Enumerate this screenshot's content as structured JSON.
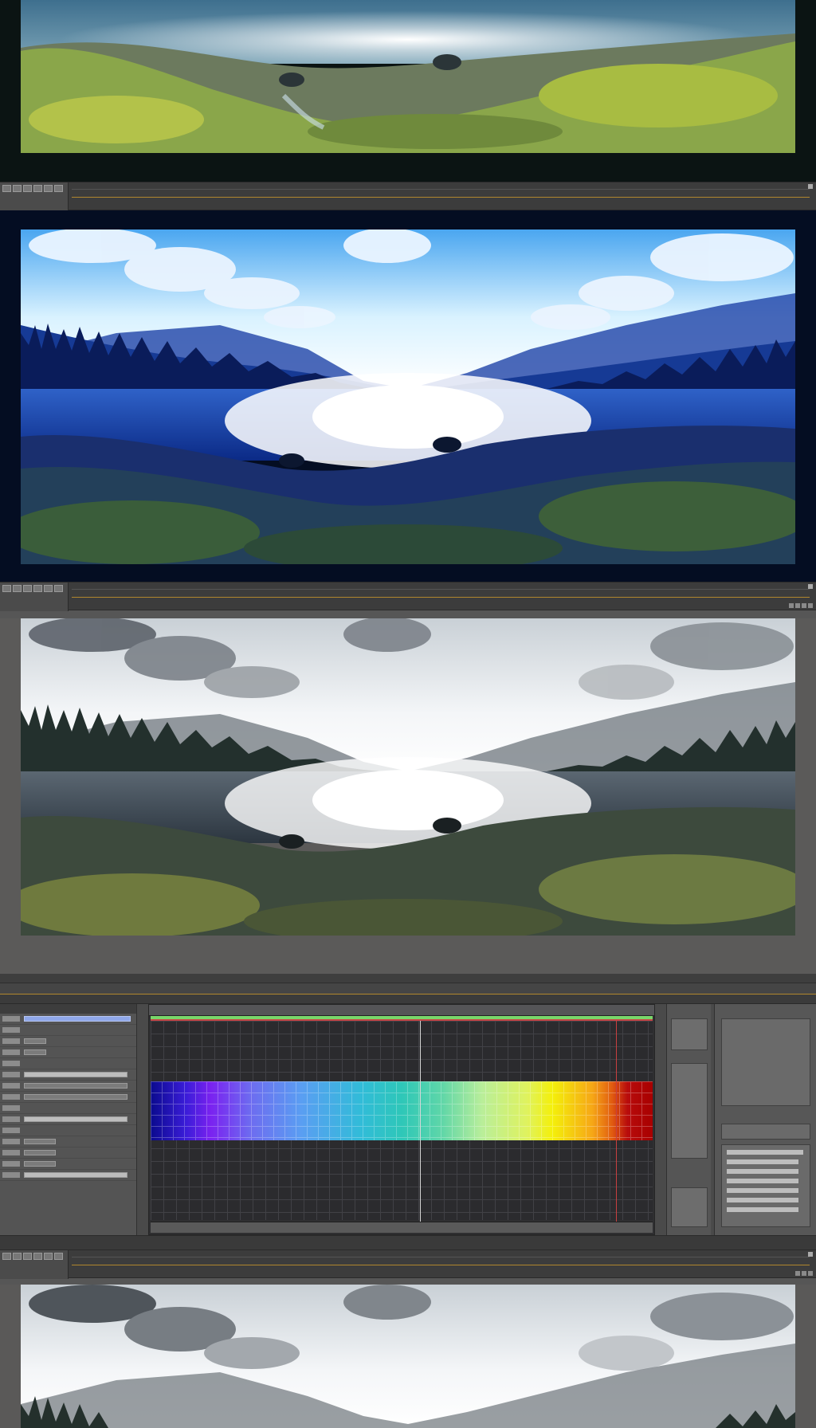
{
  "app": {
    "menu_text": "",
    "colors": {
      "accent_line": "#b0872e",
      "timeline_green": "#79d66a",
      "timeline_red": "#c84646",
      "panel_bg": "#545454"
    }
  },
  "frames": [
    {
      "name": "lake-landscape-natural"
    },
    {
      "name": "lake-landscape-blue-tint"
    },
    {
      "name": "lake-landscape-desaturated"
    },
    {
      "name": "lake-landscape-bright"
    }
  ],
  "timeline": {
    "playhead_fraction": 0.536,
    "end_marker_fraction": 0.925
  },
  "icons": [
    "panel-toggle-icon",
    "record-icon",
    "settings-icon"
  ]
}
